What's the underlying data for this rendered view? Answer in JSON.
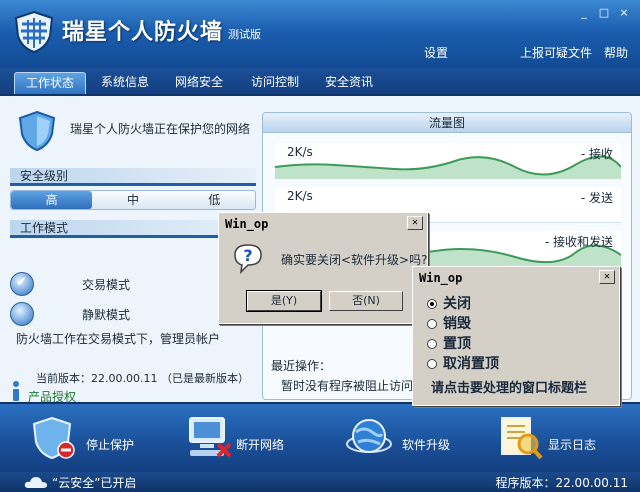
{
  "app": {
    "title": "瑞星个人防火墙",
    "edition": "测试版",
    "window_buttons": [
      "_",
      "□",
      "×"
    ],
    "links": [
      "设置",
      "上报可疑文件",
      "帮助"
    ]
  },
  "tabs": [
    {
      "label": "工作状态",
      "active": true
    },
    {
      "label": "系统信息",
      "active": false
    },
    {
      "label": "网络安全",
      "active": false
    },
    {
      "label": "访问控制",
      "active": false
    },
    {
      "label": "安全资讯",
      "active": false
    }
  ],
  "status": {
    "protect_text": "瑞星个人防火墙正在保护您的网络",
    "security_level_title": "安全级别",
    "levels": [
      "高",
      "中",
      "低"
    ],
    "active_level": "高",
    "work_mode_title": "工作模式",
    "modes": [
      {
        "label": "交易模式",
        "checked": true
      },
      {
        "label": "静默模式",
        "checked": false
      }
    ],
    "mode_desc": "防火墙工作在交易模式下，管理员帐户",
    "version_line": "当前版本：22.00.00.11  （已是最新版本）",
    "license_link": "产品授权"
  },
  "traffic": {
    "header": "流量图",
    "graphs": [
      {
        "rate": "2K/s",
        "label": "- 接收"
      },
      {
        "rate": "2K/s",
        "label": "- 发送"
      },
      {
        "rate": "",
        "label": "- 接收和发送"
      }
    ],
    "recent_title": "最近操作：",
    "recent_text": "暂时没有程序被阻止访问"
  },
  "toolbar": [
    {
      "label": "停止保护",
      "icon": "shield-stop-icon"
    },
    {
      "label": "断开网络",
      "icon": "network-disconnect-icon"
    },
    {
      "label": "软件升级",
      "icon": "globe-upgrade-icon"
    },
    {
      "label": "显示日志",
      "icon": "log-magnifier-icon"
    }
  ],
  "statusbar": {
    "cloud_text": "“云安全”已开启",
    "program_version": "程序版本：22.00.00.11"
  },
  "dialog_confirm": {
    "title": "Win_op",
    "message": "确实要关闭<软件升级>吗?",
    "yes": "是(Y)",
    "no": "否(N)"
  },
  "dialog_options": {
    "title": "Win_op",
    "options": [
      {
        "label": "关闭",
        "checked": true
      },
      {
        "label": "销毁",
        "checked": false
      },
      {
        "label": "置顶",
        "checked": false
      },
      {
        "label": "取消置顶",
        "checked": false
      }
    ],
    "hint": "请点击要处理的窗口标题栏"
  },
  "colors": {
    "accent_blue": "#1b5fb0",
    "graph_green": "#3f9a5a",
    "link_green": "#1a7a2a"
  }
}
